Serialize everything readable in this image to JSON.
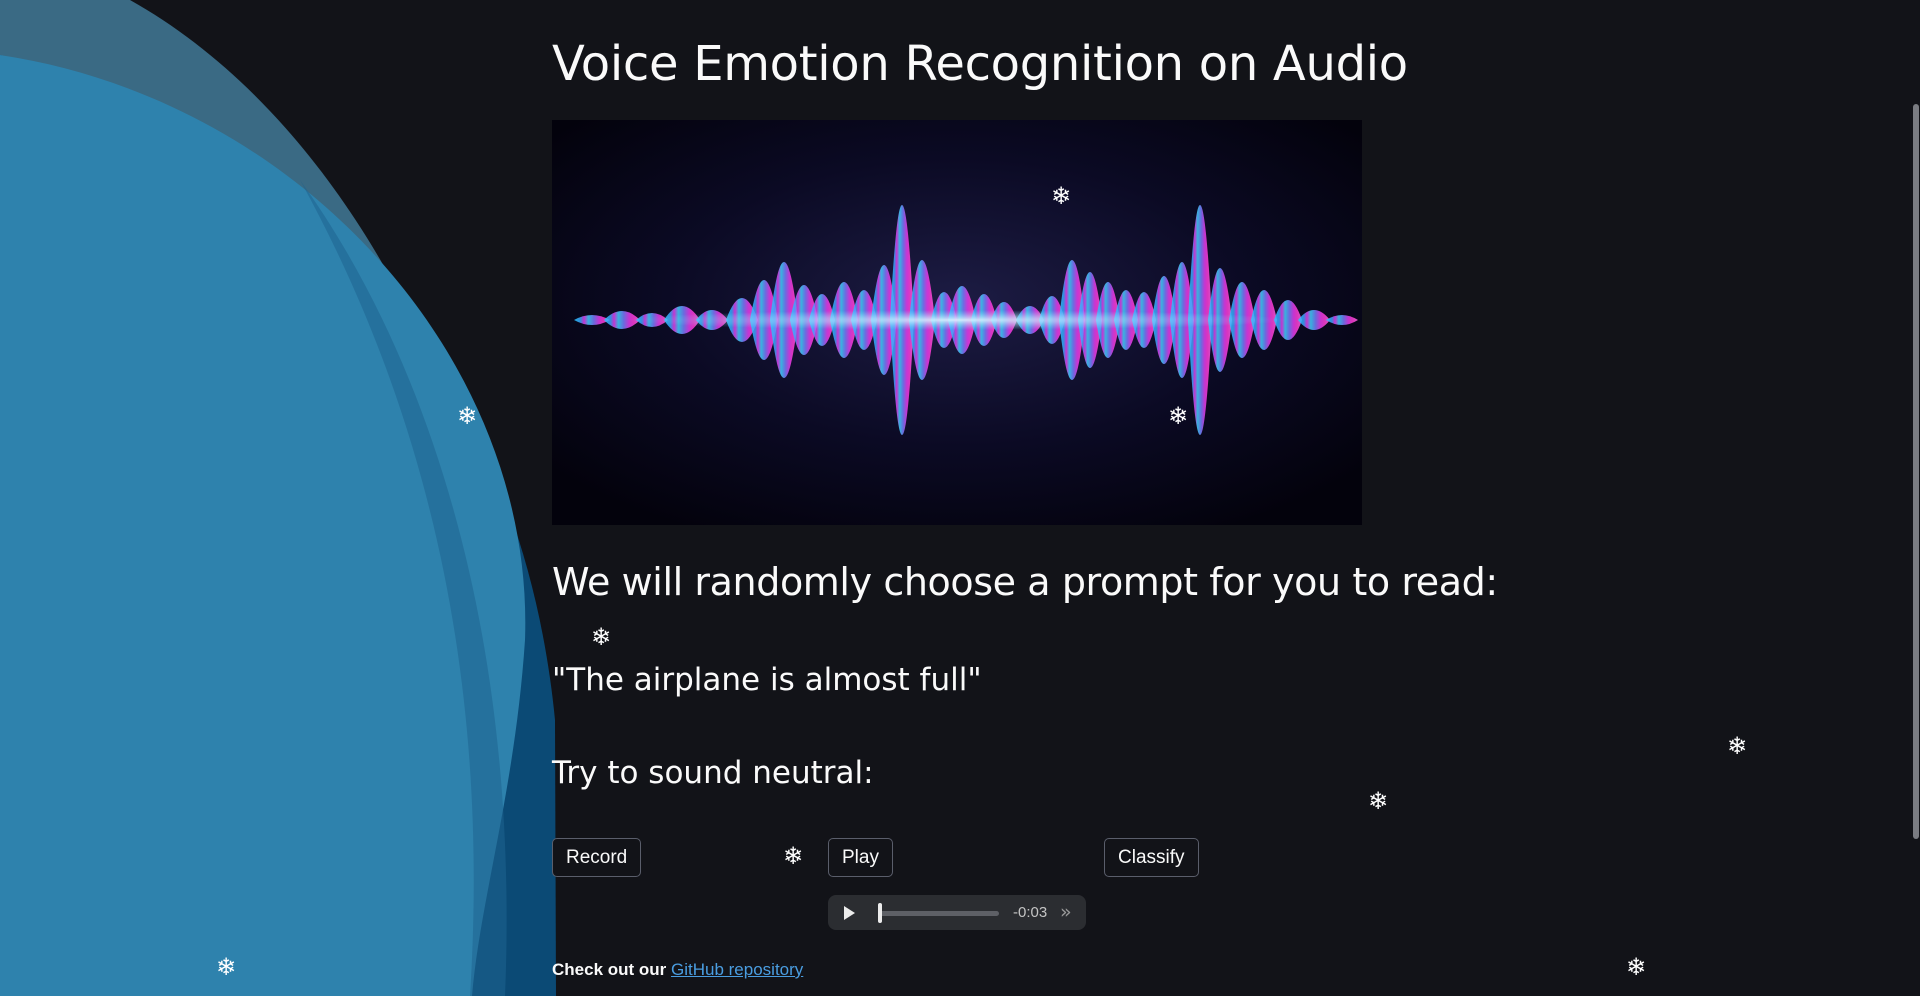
{
  "page": {
    "title": "Voice Emotion Recognition on Audio",
    "prompt_heading": "We will randomly choose a prompt for you to read:",
    "prompt_text": "\"The airplane is almost full\"",
    "emotion_instruction": "Try to sound neutral:"
  },
  "buttons": {
    "record": "Record",
    "play": "Play",
    "classify": "Classify"
  },
  "audio_player": {
    "remaining_time": "-0:03",
    "progress": 0.0
  },
  "footer": {
    "prefix": "Check out our ",
    "link_text": "GitHub repository"
  },
  "icons": {
    "snowflake": "❄",
    "audio_play": "play-icon",
    "audio_skip": "fast-forward-icon"
  },
  "colors": {
    "background": "#121318",
    "blob_light": "#2f82ad",
    "blob_mid": "#3a6e8c",
    "blob_dark": "#0b4a75",
    "link": "#4a9de0",
    "wave_cyan": "#28c8ff",
    "wave_magenta": "#e63cf0"
  }
}
